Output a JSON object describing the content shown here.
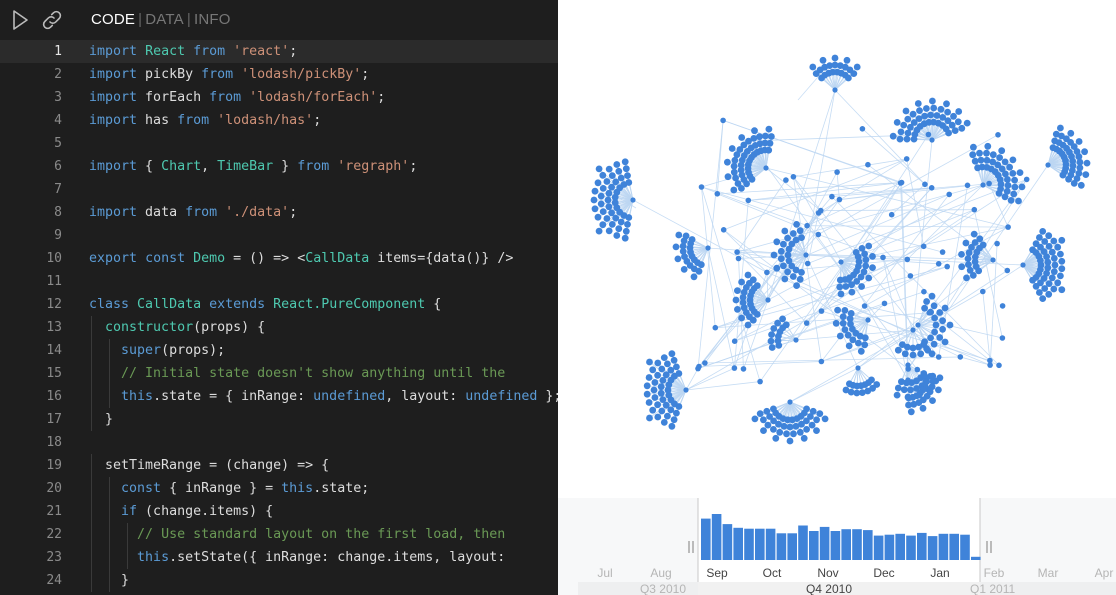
{
  "toolbar": {
    "tabs": [
      {
        "label": "CODE",
        "active": true
      },
      {
        "label": "DATA",
        "active": false
      },
      {
        "label": "INFO",
        "active": false
      }
    ],
    "separator": "|",
    "icons": [
      "play-icon",
      "link-icon"
    ]
  },
  "editor": {
    "current_line": 1,
    "lines": [
      {
        "n": "1",
        "indent": 0,
        "tokens": [
          [
            "kw",
            "import"
          ],
          [
            "pl",
            " "
          ],
          [
            "cls",
            "React"
          ],
          [
            "pl",
            " "
          ],
          [
            "kw",
            "from"
          ],
          [
            "pl",
            " "
          ],
          [
            "str",
            "'react'"
          ],
          [
            "pl",
            ";"
          ]
        ]
      },
      {
        "n": "2",
        "indent": 0,
        "tokens": [
          [
            "kw",
            "import"
          ],
          [
            "pl",
            " pickBy "
          ],
          [
            "kw",
            "from"
          ],
          [
            "pl",
            " "
          ],
          [
            "str",
            "'lodash/pickBy'"
          ],
          [
            "pl",
            ";"
          ]
        ]
      },
      {
        "n": "3",
        "indent": 0,
        "tokens": [
          [
            "kw",
            "import"
          ],
          [
            "pl",
            " forEach "
          ],
          [
            "kw",
            "from"
          ],
          [
            "pl",
            " "
          ],
          [
            "str",
            "'lodash/forEach'"
          ],
          [
            "pl",
            ";"
          ]
        ]
      },
      {
        "n": "4",
        "indent": 0,
        "tokens": [
          [
            "kw",
            "import"
          ],
          [
            "pl",
            " has "
          ],
          [
            "kw",
            "from"
          ],
          [
            "pl",
            " "
          ],
          [
            "str",
            "'lodash/has'"
          ],
          [
            "pl",
            ";"
          ]
        ]
      },
      {
        "n": "5",
        "indent": 0,
        "tokens": []
      },
      {
        "n": "6",
        "indent": 0,
        "tokens": [
          [
            "kw",
            "import"
          ],
          [
            "pl",
            " { "
          ],
          [
            "cls",
            "Chart"
          ],
          [
            "pl",
            ", "
          ],
          [
            "cls",
            "TimeBar"
          ],
          [
            "pl",
            " } "
          ],
          [
            "kw",
            "from"
          ],
          [
            "pl",
            " "
          ],
          [
            "str",
            "'regraph'"
          ],
          [
            "pl",
            ";"
          ]
        ]
      },
      {
        "n": "7",
        "indent": 0,
        "tokens": []
      },
      {
        "n": "8",
        "indent": 0,
        "tokens": [
          [
            "kw",
            "import"
          ],
          [
            "pl",
            " data "
          ],
          [
            "kw",
            "from"
          ],
          [
            "pl",
            " "
          ],
          [
            "str",
            "'./data'"
          ],
          [
            "pl",
            ";"
          ]
        ]
      },
      {
        "n": "9",
        "indent": 0,
        "tokens": []
      },
      {
        "n": "10",
        "indent": 0,
        "tokens": [
          [
            "kw",
            "export"
          ],
          [
            "pl",
            " "
          ],
          [
            "kw",
            "const"
          ],
          [
            "pl",
            " "
          ],
          [
            "cls",
            "Demo"
          ],
          [
            "pl",
            " = () => <"
          ],
          [
            "cls",
            "CallData"
          ],
          [
            "pl",
            " items={data()} />"
          ]
        ]
      },
      {
        "n": "11",
        "indent": 0,
        "tokens": []
      },
      {
        "n": "12",
        "indent": 0,
        "tokens": [
          [
            "kw",
            "class"
          ],
          [
            "pl",
            " "
          ],
          [
            "cls",
            "CallData"
          ],
          [
            "pl",
            " "
          ],
          [
            "kw",
            "extends"
          ],
          [
            "pl",
            " "
          ],
          [
            "cls",
            "React.PureComponent"
          ],
          [
            "pl",
            " {"
          ]
        ]
      },
      {
        "n": "13",
        "indent": 1,
        "tokens": [
          [
            "pl",
            "  "
          ],
          [
            "cls",
            "constructor"
          ],
          [
            "pl",
            "(props) {"
          ]
        ]
      },
      {
        "n": "14",
        "indent": 2,
        "tokens": [
          [
            "pl",
            "    "
          ],
          [
            "kw",
            "super"
          ],
          [
            "pl",
            "(props);"
          ]
        ]
      },
      {
        "n": "15",
        "indent": 2,
        "tokens": [
          [
            "pl",
            "    "
          ],
          [
            "cm",
            "// Initial state doesn't show anything until the"
          ]
        ]
      },
      {
        "n": "16",
        "indent": 2,
        "tokens": [
          [
            "pl",
            "    "
          ],
          [
            "kw",
            "this"
          ],
          [
            "pl",
            ".state = { inRange: "
          ],
          [
            "kw",
            "undefined"
          ],
          [
            "pl",
            ", layout: "
          ],
          [
            "kw",
            "undefined"
          ],
          [
            "pl",
            " };"
          ]
        ]
      },
      {
        "n": "17",
        "indent": 1,
        "tokens": [
          [
            "pl",
            "  }"
          ]
        ]
      },
      {
        "n": "18",
        "indent": 0,
        "tokens": []
      },
      {
        "n": "19",
        "indent": 1,
        "tokens": [
          [
            "pl",
            "  setTimeRange = (change) => {"
          ]
        ]
      },
      {
        "n": "20",
        "indent": 2,
        "tokens": [
          [
            "pl",
            "    "
          ],
          [
            "kw",
            "const"
          ],
          [
            "pl",
            " { inRange } = "
          ],
          [
            "kw",
            "this"
          ],
          [
            "pl",
            ".state;"
          ]
        ]
      },
      {
        "n": "21",
        "indent": 2,
        "tokens": [
          [
            "pl",
            "    "
          ],
          [
            "kw",
            "if"
          ],
          [
            "pl",
            " (change.items) {"
          ]
        ]
      },
      {
        "n": "22",
        "indent": 3,
        "tokens": [
          [
            "pl",
            "      "
          ],
          [
            "cm",
            "// Use standard layout on the first load, then"
          ]
        ]
      },
      {
        "n": "23",
        "indent": 3,
        "tokens": [
          [
            "pl",
            "      "
          ],
          [
            "kw",
            "this"
          ],
          [
            "pl",
            ".setState({ inRange: change.items, layout:"
          ]
        ]
      },
      {
        "n": "24",
        "indent": 2,
        "tokens": [
          [
            "pl",
            "    }"
          ]
        ]
      }
    ]
  },
  "timebar": {
    "month_labels": [
      "Jul",
      "Aug",
      "Sep",
      "Oct",
      "Nov",
      "Dec",
      "Jan",
      "Feb",
      "Mar",
      "Apr"
    ],
    "quarter_labels": [
      "Q3 2010",
      "Q4 2010",
      "Q1 2011"
    ],
    "bar_values": [
      0.9,
      1.0,
      0.78,
      0.7,
      0.68,
      0.68,
      0.68,
      0.58,
      0.58,
      0.75,
      0.63,
      0.72,
      0.63,
      0.67,
      0.67,
      0.65,
      0.53,
      0.55,
      0.57,
      0.53,
      0.59,
      0.52,
      0.57,
      0.57,
      0.55,
      0.07
    ],
    "colors": {
      "bar": "#3f83d9",
      "handle": "#bbbbbb",
      "selection": "#ffffff",
      "outside": "#f7f8f9"
    }
  },
  "network": {
    "node_color": "#3f83d9",
    "link_color": "#bcd6f2"
  }
}
